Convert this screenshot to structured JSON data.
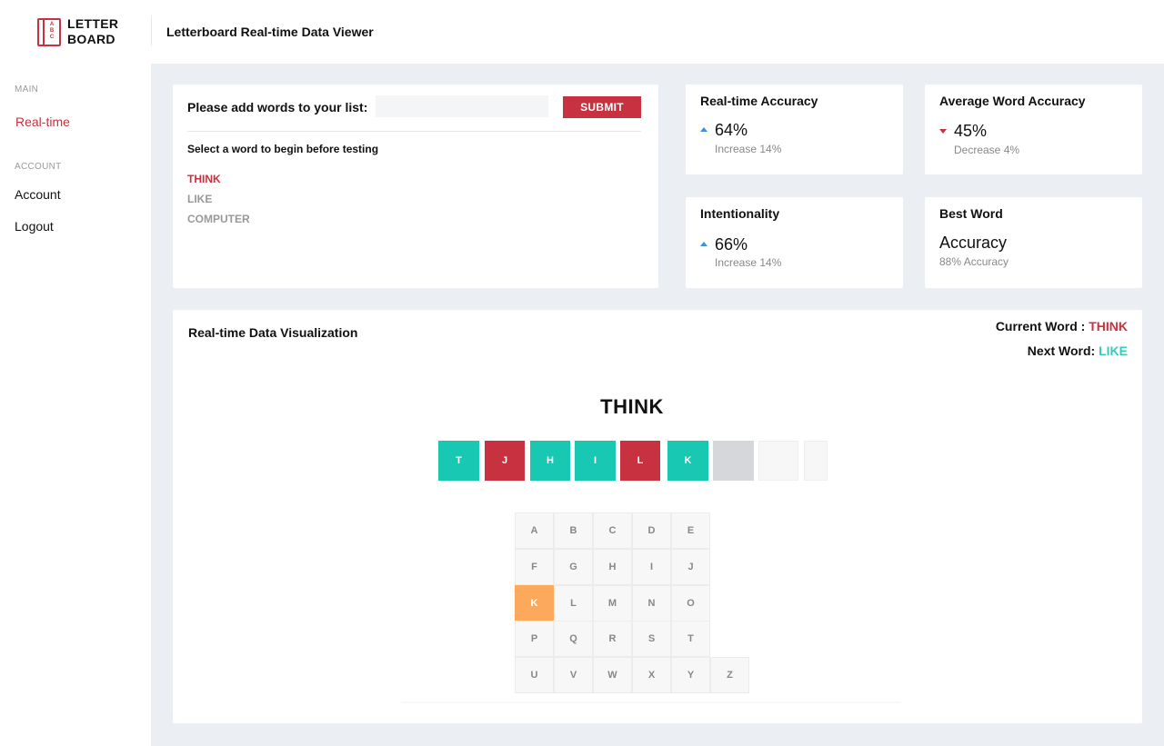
{
  "header": {
    "logo_line1": "LETTER",
    "logo_line2": "BOARD",
    "logo_letters": [
      "A",
      "B",
      "C"
    ],
    "title": "Letterboard Real-time Data Viewer"
  },
  "sidebar": {
    "section_main": "MAIN",
    "realtime": "Real-time",
    "section_account": "ACCOUNT",
    "account": "Account",
    "logout": "Logout"
  },
  "wordlist": {
    "prompt": "Please add words to your list:",
    "input_value": "",
    "submit": "SUBMIT",
    "hint": "Select a word to begin before testing",
    "words": [
      "THINK",
      "LIKE",
      "COMPUTER"
    ],
    "selected": "THINK"
  },
  "stats": {
    "realtime_accuracy": {
      "title": "Real-time Accuracy",
      "value": "64%",
      "sub": "Increase 14%",
      "trend": "up"
    },
    "average_word_accuracy": {
      "title": "Average Word Accuracy",
      "value": "45%",
      "sub": "Decrease 4%",
      "trend": "down"
    },
    "intentionality": {
      "title": "Intentionality",
      "value": "66%",
      "sub": "Increase 14%",
      "trend": "up"
    },
    "best_word": {
      "title": "Best Word",
      "value": "Accuracy",
      "sub": "88% Accuracy"
    }
  },
  "visualization": {
    "title": "Real-time Data Visualization",
    "current_word_label": "Current Word : ",
    "current_word": "THINK",
    "next_word_label": "Next Word: ",
    "next_word": "LIKE",
    "target_word": "THINK",
    "tiles": [
      {
        "letter": "T",
        "state": "correct"
      },
      {
        "letter": "J",
        "state": "wrong"
      },
      {
        "letter": "H",
        "state": "correct"
      },
      {
        "letter": "I",
        "state": "correct"
      },
      {
        "letter": "L",
        "state": "wrong"
      },
      {
        "letter": "K",
        "state": "correct"
      },
      {
        "letter": "",
        "state": "pending"
      },
      {
        "letter": "",
        "state": "empty"
      },
      {
        "letter": "",
        "state": "empty"
      }
    ],
    "keyboard_rows": [
      [
        "A",
        "B",
        "C",
        "D",
        "E"
      ],
      [
        "F",
        "G",
        "H",
        "I",
        "J"
      ],
      [
        "K",
        "L",
        "M",
        "N",
        "O"
      ],
      [
        "P",
        "Q",
        "R",
        "S",
        "T"
      ],
      [
        "U",
        "V",
        "W",
        "X",
        "Y",
        "Z"
      ]
    ],
    "highlighted_key": "K"
  },
  "colors": {
    "brand_red": "#c8313f",
    "teal": "#19c8b2",
    "highlight_orange": "#fda95b",
    "up_arrow_blue": "#3d8fe0"
  }
}
